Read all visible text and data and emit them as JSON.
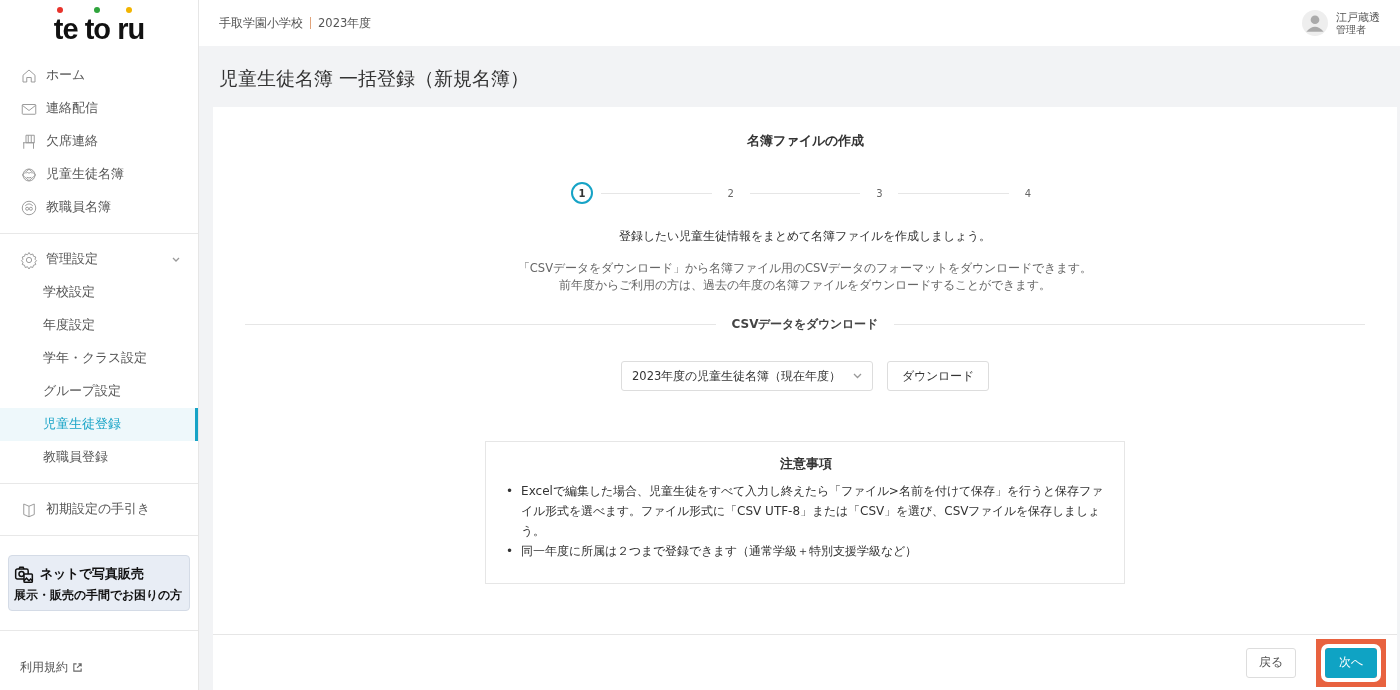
{
  "logo": {
    "text": "te to ru"
  },
  "sidebar": {
    "nav": [
      {
        "label": "ホーム"
      },
      {
        "label": "連絡配信"
      },
      {
        "label": "欠席連絡"
      },
      {
        "label": "児童生徒名簿"
      },
      {
        "label": "教職員名簿"
      }
    ],
    "settings": {
      "label": "管理設定",
      "expanded": true,
      "children": [
        {
          "label": "学校設定",
          "selected": false
        },
        {
          "label": "年度設定",
          "selected": false
        },
        {
          "label": "学年・クラス設定",
          "selected": false
        },
        {
          "label": "グループ設定",
          "selected": false
        },
        {
          "label": "児童生徒登録",
          "selected": true
        },
        {
          "label": "教職員登録",
          "selected": false
        }
      ]
    },
    "guide": {
      "label": "初期設定の手引き"
    },
    "banner": {
      "title": "ネットで写真販売",
      "subtitle": "展示・販売の手間でお困りの方"
    },
    "footer_link": {
      "label": "利用規約"
    }
  },
  "header": {
    "school": "手取学園小学校",
    "year": "2023年度",
    "user_name": "江戸蔵透",
    "user_role": "管理者"
  },
  "page_title": "児童生徒名簿 一括登録（新規名簿）",
  "card": {
    "heading": "名簿ファイルの作成",
    "steps": [
      {
        "label": "1",
        "selected": true
      },
      {
        "label": "2",
        "selected": false
      },
      {
        "label": "3",
        "selected": false
      },
      {
        "label": "4",
        "selected": false
      }
    ],
    "intro": "登録したい児童生徒情報をまとめて名簿ファイルを作成しましょう。",
    "description": [
      "「CSVデータをダウンロード」から名簿ファイル用のCSVデータのフォーマットをダウンロードできます。",
      "前年度からご利用の方は、過去の年度の名簿ファイルをダウンロードすることができます。"
    ],
    "section_label": "CSVデータをダウンロード",
    "select": {
      "value": "2023年度の児童生徒名簿（現在年度）"
    },
    "download_button": "ダウンロード",
    "notes": {
      "title": "注意事項",
      "items": [
        {
          "marker": "•",
          "text": "Excelで編集した場合、児童生徒をすべて入力し終えたら「ファイル>名前を付けて保存」を行うと保存ファイル形式を選べます。ファイル形式に「CSV UTF-8」または「CSV」を選び、CSVファイルを保存しましょう。"
        },
        {
          "marker": "•",
          "text": "同一年度に所属は２つまで登録できます（通常学級＋特別支援学級など）"
        }
      ]
    },
    "buttons": [
      {
        "kind": "secondary",
        "label": "戻る",
        "highlighted": false
      },
      {
        "kind": "primary",
        "label": "次へ",
        "highlighted": true
      }
    ]
  }
}
